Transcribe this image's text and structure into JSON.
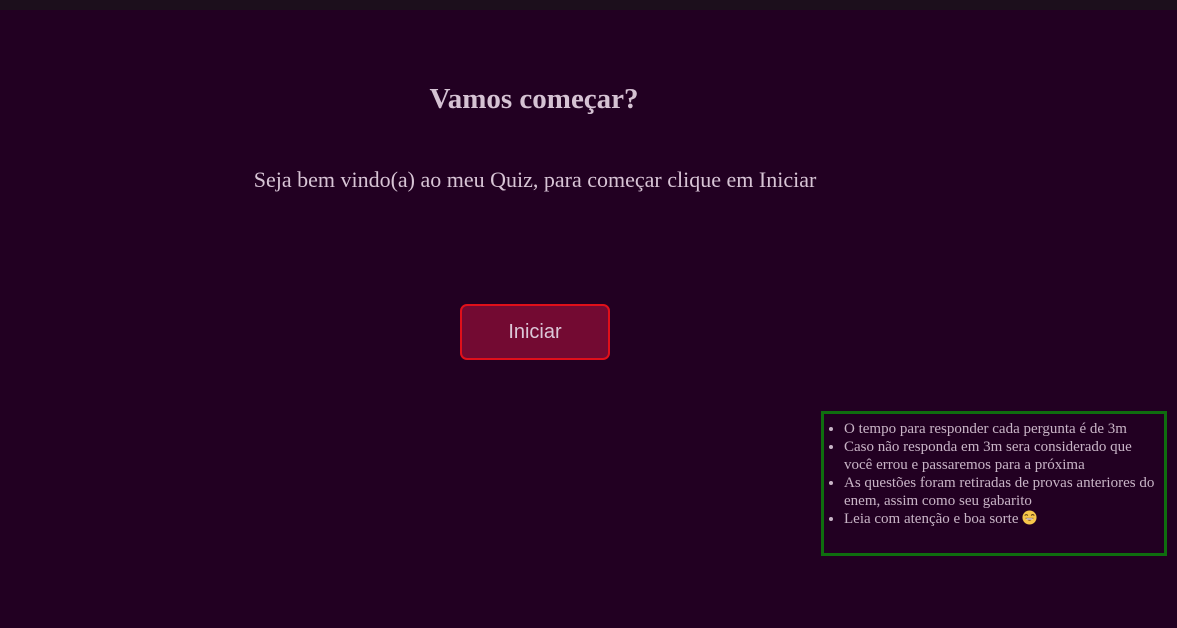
{
  "page": {
    "title": "Vamos começar?",
    "welcome": "Seja bem vindo(a) ao meu Quiz, para começar clique em Iniciar"
  },
  "start_button": {
    "label": "Iniciar"
  },
  "rules": {
    "items": [
      "O tempo para responder cada pergunta é de 3m",
      "Caso não responda em 3m sera considerado que você errou e passaremos para a próxima",
      "As questões foram retiradas de provas anteriores do enem, assim como seu gabarito",
      "Leia com atenção e boa sorte"
    ]
  },
  "icons": {
    "smile": "grinning-face-icon"
  },
  "colors": {
    "background": "#220022",
    "button_fill": "#730a32",
    "button_border": "#e0101a",
    "rules_border": "#0f6e0f",
    "text": "#d8c3d6"
  }
}
